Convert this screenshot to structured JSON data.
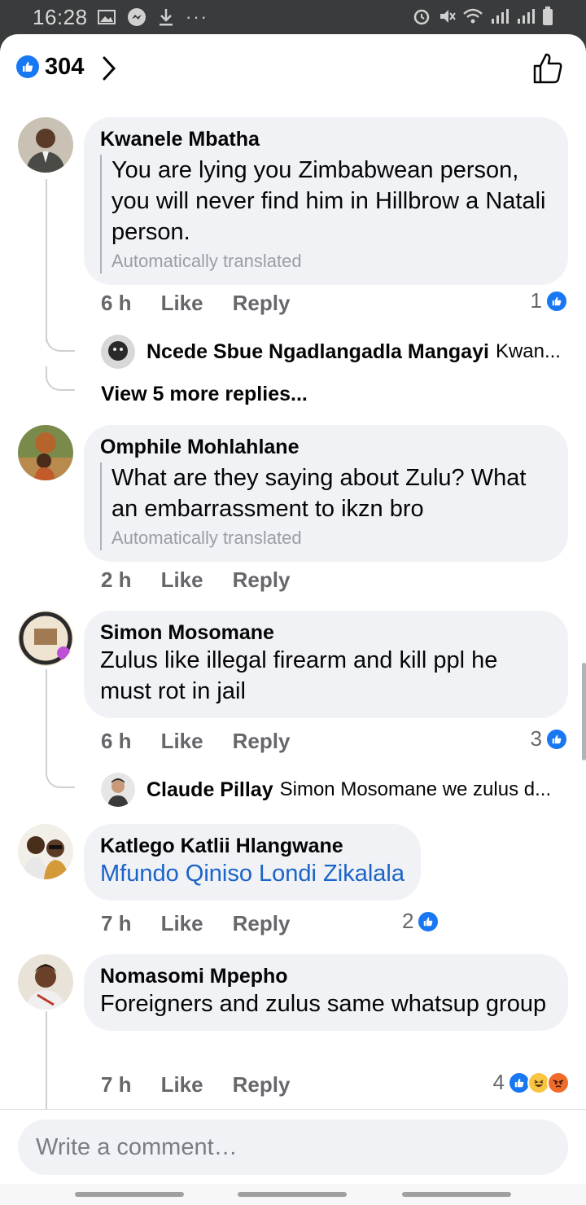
{
  "status_bar": {
    "time": "16:28",
    "more": "···"
  },
  "header": {
    "reaction_count": "304"
  },
  "comments": [
    {
      "author": "Kwanele Mbatha",
      "text": "You are lying you Zimbabwean person, you will never find him in Hillbrow a Natali person.",
      "translated_note": "Automatically translated",
      "time": "6 h",
      "like_label": "Like",
      "reply_label": "Reply",
      "reactions": "1",
      "reply_preview": {
        "author": "Ncede Sbue Ngadlangadla Mangayi",
        "snippet": "Kwan..."
      },
      "view_more": "View 5 more replies..."
    },
    {
      "author": "Omphile Mohlahlane",
      "text": "What are they saying about Zulu? What an embarrassment to ikzn bro",
      "translated_note": "Automatically translated",
      "time": "2 h",
      "like_label": "Like",
      "reply_label": "Reply"
    },
    {
      "author": "Simon Mosomane",
      "text": "Zulus like illegal firearm and kill ppl he must rot in jail",
      "time": "6 h",
      "like_label": "Like",
      "reply_label": "Reply",
      "reactions": "3",
      "reply_preview": {
        "author": "Claude Pillay",
        "snippet": "Simon Mosomane we zulus d..."
      }
    },
    {
      "author": "Katlego Katlii Hlangwane",
      "text": "Mfundo Qiniso Londi Zikalala",
      "time": "7 h",
      "like_label": "Like",
      "reply_label": "Reply",
      "reactions": "2"
    },
    {
      "author": "Nomasomi Mpepho",
      "text": "Foreigners and zulus same whatsup group",
      "time": "7 h",
      "like_label": "Like",
      "reply_label": "Reply",
      "reactions": "4"
    }
  ],
  "composer": {
    "placeholder": "Write a comment…"
  },
  "colors": {
    "accent": "#1877f2",
    "bubble": "#f0f2f5",
    "link": "#1a63c8"
  }
}
